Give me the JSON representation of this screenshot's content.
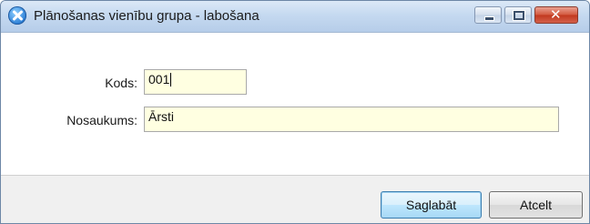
{
  "window": {
    "title": "Plānošanas vienību grupa - labošana",
    "buttons": {
      "minimize_icon": "minimize-icon",
      "maximize_icon": "maximize-icon",
      "close_icon": "close-icon",
      "close_glyph": "✕"
    }
  },
  "form": {
    "code_label": "Kods:",
    "code_value": "001",
    "name_label": "Nosaukums:",
    "name_value": "Ārsti",
    "field_background": "#ffffe1"
  },
  "footer": {
    "save_label": "Saglabāt",
    "cancel_label": "Atcelt"
  }
}
